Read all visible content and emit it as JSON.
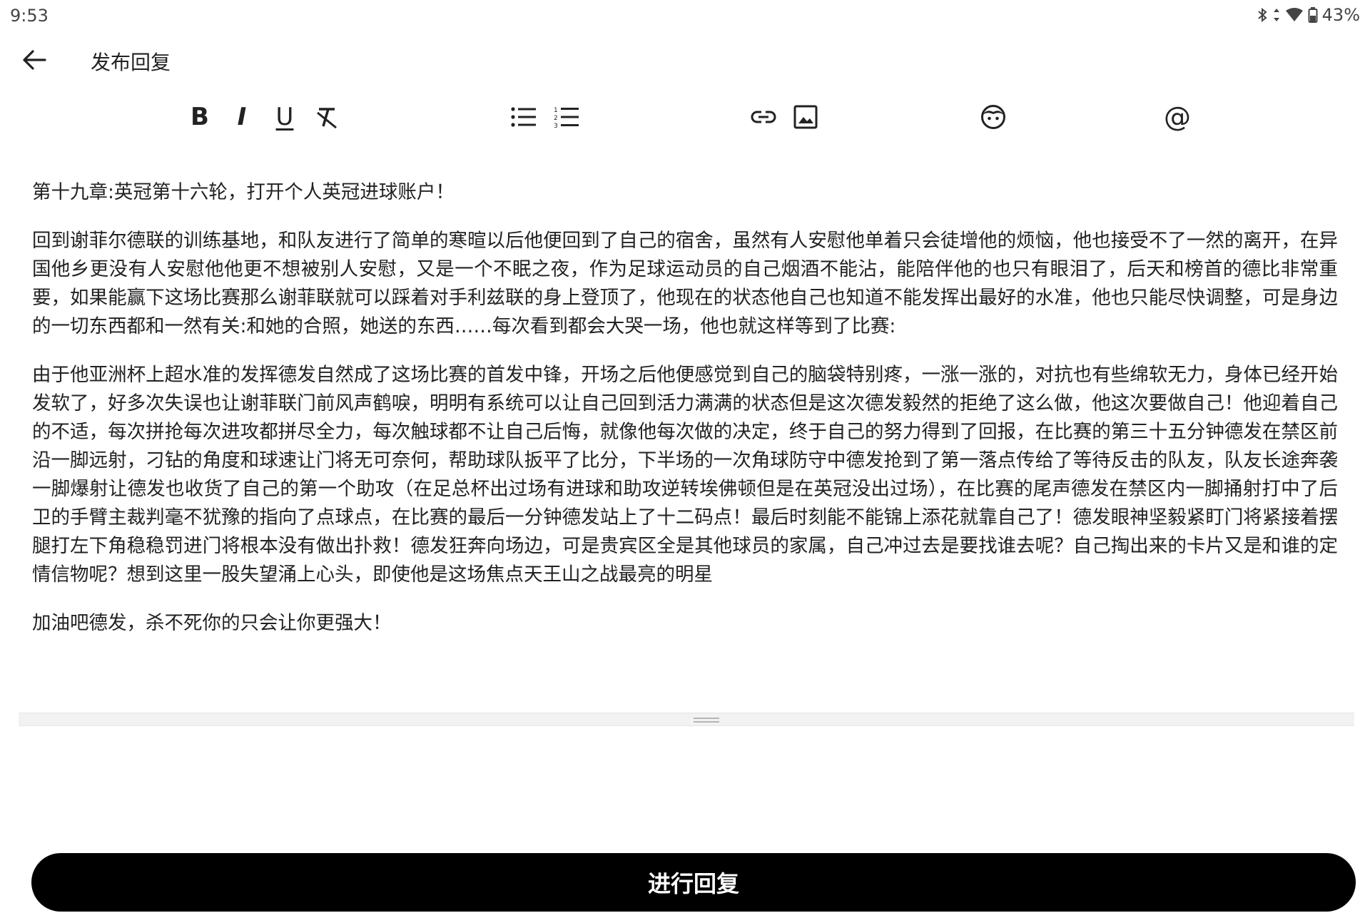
{
  "status_bar": {
    "time": "9:53",
    "battery": "43%",
    "icons": [
      "bluetooth-icon",
      "data-arrows-icon",
      "wifi-icon",
      "battery-icon"
    ]
  },
  "app_bar": {
    "back_icon": "arrow-back-icon",
    "title": "发布回复"
  },
  "toolbar": {
    "tools": [
      {
        "name": "bold",
        "icon": "bold-icon",
        "glyph": "B"
      },
      {
        "name": "italic",
        "icon": "italic-icon",
        "glyph": "I"
      },
      {
        "name": "underline",
        "icon": "underline-icon",
        "glyph": "U"
      },
      {
        "name": "clear-format",
        "icon": "clear-format-icon"
      },
      {
        "name": "bulleted-list",
        "icon": "bulleted-list-icon"
      },
      {
        "name": "numbered-list",
        "icon": "numbered-list-icon"
      },
      {
        "name": "link",
        "icon": "link-icon"
      },
      {
        "name": "image",
        "icon": "image-icon"
      },
      {
        "name": "emoji",
        "icon": "emoji-icon"
      },
      {
        "name": "mention",
        "icon": "at-icon",
        "glyph": "@"
      }
    ]
  },
  "editor": {
    "paragraphs": [
      "第十九章:英冠第十六轮，打开个人英冠进球账户！",
      "回到谢菲尔德联的训练基地，和队友进行了简单的寒暄以后他便回到了自己的宿舍，虽然有人安慰他单着只会徒增他的烦恼，他也接受不了一然的离开，在异国他乡更没有人安慰他他更不想被别人安慰，又是一个不眠之夜，作为足球运动员的自己烟酒不能沾，能陪伴他的也只有眼泪了，后天和榜首的德比非常重要，如果能赢下这场比赛那么谢菲联就可以踩着对手利兹联的身上登顶了，他现在的状态他自己也知道不能发挥出最好的水准，他也只能尽快调整，可是身边的一切东西都和一然有关:和她的合照，她送的东西……每次看到都会大哭一场，他也就这样等到了比赛:",
      "由于他亚洲杯上超水准的发挥德发自然成了这场比赛的首发中锋，开场之后他便感觉到自己的脑袋特别疼，一涨一涨的，对抗也有些绵软无力，身体已经开始发软了，好多次失误也让谢菲联门前风声鹤唳，明明有系统可以让自己回到活力满满的状态但是这次德发毅然的拒绝了这么做，他这次要做自己！他迎着自己的不适，每次拼抢每次进攻都拼尽全力，每次触球都不让自己后悔，就像他每次做的决定，终于自己的努力得到了回报，在比赛的第三十五分钟德发在禁区前沿一脚远射，刁钻的角度和球速让门将无可奈何，帮助球队扳平了比分，下半场的一次角球防守中德发抢到了第一落点传给了等待反击的队友，队友长途奔袭一脚爆射让德发也收货了自己的第一个助攻（在足总杯出过场有进球和助攻逆转埃佛顿但是在英冠没出过场），在比赛的尾声德发在禁区内一脚捅射打中了后卫的手臂主裁判毫不犹豫的指向了点球点，在比赛的最后一分钟德发站上了十二码点！最后时刻能不能锦上添花就靠自己了！德发眼神坚毅紧盯门将紧接着摆腿打左下角稳稳罚进门将根本没有做出扑救！德发狂奔向场边，可是贵宾区全是其他球员的家属，自己冲过去是要找谁去呢？自己掏出来的卡片又是和谁的定情信物呢？想到这里一股失望涌上心头，即使他是这场焦点天王山之战最亮的明星",
      "加油吧德发，杀不死你的只会让你更强大！"
    ]
  },
  "submit": {
    "label": "进行回复"
  }
}
